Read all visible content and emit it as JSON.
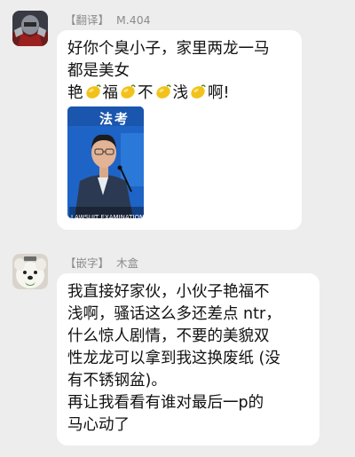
{
  "messages": [
    {
      "sender_tag": "【翻译】",
      "sender_name": "M.404",
      "avatar": "armored-warrior-avatar",
      "text_lines": [
        "好你个臭小子，家里两龙一马",
        "都是美女"
      ],
      "emoji_line": [
        "艳",
        "lemon-emoji",
        "福",
        "lemon-emoji",
        "不",
        "lemon-emoji",
        "浅",
        "lemon-emoji",
        "啊!"
      ],
      "image": {
        "title": "法考",
        "caption": "LAWSUIT EXAMINATION",
        "icon": "speaker-at-lectern-image"
      }
    },
    {
      "sender_tag": "【嵌字】",
      "sender_name": "木盒",
      "avatar": "white-dog-avatar",
      "text_lines": [
        "我直接好家伙，小伙子艳福不",
        "浅啊，骚话这么多还差点 ntr，",
        "什么惊人剧情，不要的美貌双",
        "性龙龙可以拿到我这换废纸 (没",
        "有不锈钢盆)。",
        "再让我看看有谁对最后一p的",
        "马心动了"
      ]
    }
  ],
  "colors": {
    "background": "#ededed",
    "bubble": "#ffffff",
    "sender_name": "#8c8c8c",
    "lemon": "#f2c21b",
    "photo_background": "#1e63c6"
  }
}
